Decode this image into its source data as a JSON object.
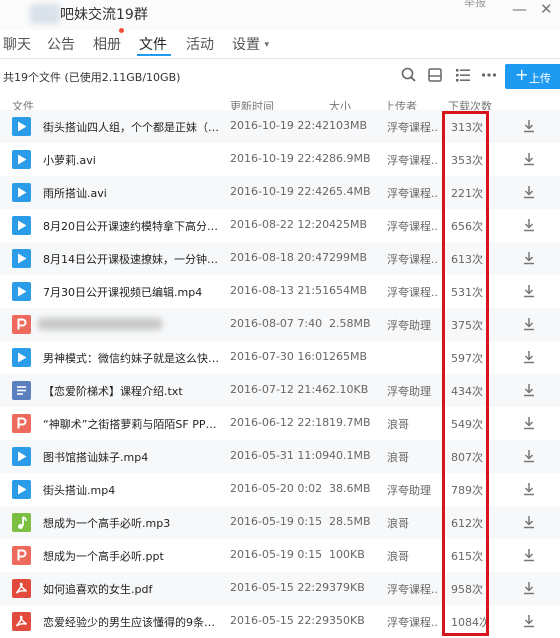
{
  "window": {
    "title": "吧妹交流19群",
    "switch_label": "举报",
    "minimize_glyph": "—",
    "close_glyph": "✕"
  },
  "tabs": [
    {
      "label": "聊天"
    },
    {
      "label": "公告"
    },
    {
      "label": "相册"
    },
    {
      "label": "文件"
    },
    {
      "label": "活动"
    },
    {
      "label": "设置"
    }
  ],
  "active_tab": "文件",
  "toolbar": {
    "file_count_text": "共19个文件 (已使用2.11GB/10GB)",
    "upload_label": "上传",
    "icons": [
      "search-icon",
      "folder-icon",
      "list-view-icon",
      "more-icon"
    ]
  },
  "columns": {
    "name": "文件",
    "modified": "更新时间",
    "size": "大小",
    "uploader": "上传者",
    "downloads": "下载次数"
  },
  "files": [
    {
      "type": "video",
      "name": "街头搭讪四人组，个个都是正妹（浮夸...",
      "date": "2016-10-19 22:42",
      "size": "103MB",
      "uploader": "浮夸课程...",
      "downloads": "313次"
    },
    {
      "type": "video",
      "name": "小萝莉.avi",
      "date": "2016-10-19 22:42",
      "size": "86.9MB",
      "uploader": "浮夸课程...",
      "downloads": "353次"
    },
    {
      "type": "video",
      "name": "雨所搭讪.avi",
      "date": "2016-10-19 22:42",
      "size": "65.4MB",
      "uploader": "浮夸课程...",
      "downloads": "221次"
    },
    {
      "type": "video",
      "name": "8月20日公开课速约模特拿下高分妹攻...",
      "date": "2016-08-22 12:20",
      "size": "425MB",
      "uploader": "浮夸课程...",
      "downloads": "656次"
    },
    {
      "type": "video",
      "name": "8月14日公开课极速撩妹，一分钟拿下...",
      "date": "2016-08-18 20:47",
      "size": "299MB",
      "uploader": "浮夸课程...",
      "downloads": "613次"
    },
    {
      "type": "video",
      "name": "7月30日公开课视频已编辑.mp4",
      "date": "2016-08-13 21:51",
      "size": "654MB",
      "uploader": "浮夸课程...",
      "downloads": "531次"
    },
    {
      "type": "ppt",
      "name": "",
      "blurred": true,
      "date": "2016-08-07 7:40",
      "size": "2.58MB",
      "uploader": "浮夸助理",
      "downloads": "375次"
    },
    {
      "type": "video",
      "name": "男神模式：微信约妹子就是这么快.....m...",
      "date": "2016-07-30 16:01",
      "size": "265MB",
      "uploader": "",
      "downloads": "597次"
    },
    {
      "type": "txt",
      "name": "【恋爱阶梯术】课程介绍.txt",
      "date": "2016-07-12 21:46",
      "size": "2.10KB",
      "uploader": "浮夸助理",
      "downloads": "434次"
    },
    {
      "type": "ppt",
      "name": "“神聊术”之街搭萝莉与陌陌SF PPT（...",
      "date": "2016-06-12 22:18",
      "size": "19.7MB",
      "uploader": "浪哥",
      "downloads": "549次"
    },
    {
      "type": "video",
      "name": "图书馆搭讪妹子.mp4",
      "date": "2016-05-31 11:09",
      "size": "40.1MB",
      "uploader": "浪哥",
      "downloads": "807次"
    },
    {
      "type": "video",
      "name": "街头搭讪.mp4",
      "date": "2016-05-20 0:02",
      "size": "38.6MB",
      "uploader": "浮夸助理",
      "downloads": "789次"
    },
    {
      "type": "audio",
      "name": "想成为一个高手必听.mp3",
      "date": "2016-05-19 0:15",
      "size": "28.5MB",
      "uploader": "浪哥",
      "downloads": "612次"
    },
    {
      "type": "ppt",
      "name": "想成为一个高手必听.ppt",
      "date": "2016-05-19 0:15",
      "size": "100KB",
      "uploader": "浪哥",
      "downloads": "615次"
    },
    {
      "type": "pdf",
      "name": "如何追喜欢的女生.pdf",
      "date": "2016-05-15 22:29",
      "size": "379KB",
      "uploader": "浮夸课程...",
      "downloads": "958次"
    },
    {
      "type": "pdf",
      "name": "恋爱经验少的男生应该懂得的9条追女...",
      "date": "2016-05-15 22:29",
      "size": "350KB",
      "uploader": "浮夸课程...",
      "downloads": "1084次"
    }
  ],
  "colors": {
    "accent": "#1e9bf0",
    "video": "#2a9ce8",
    "ppt": "#ee6a5d",
    "txt": "#5b7fbf",
    "audio": "#7bc043",
    "pdf": "#e24a3b",
    "highlight": "#d6141b"
  }
}
